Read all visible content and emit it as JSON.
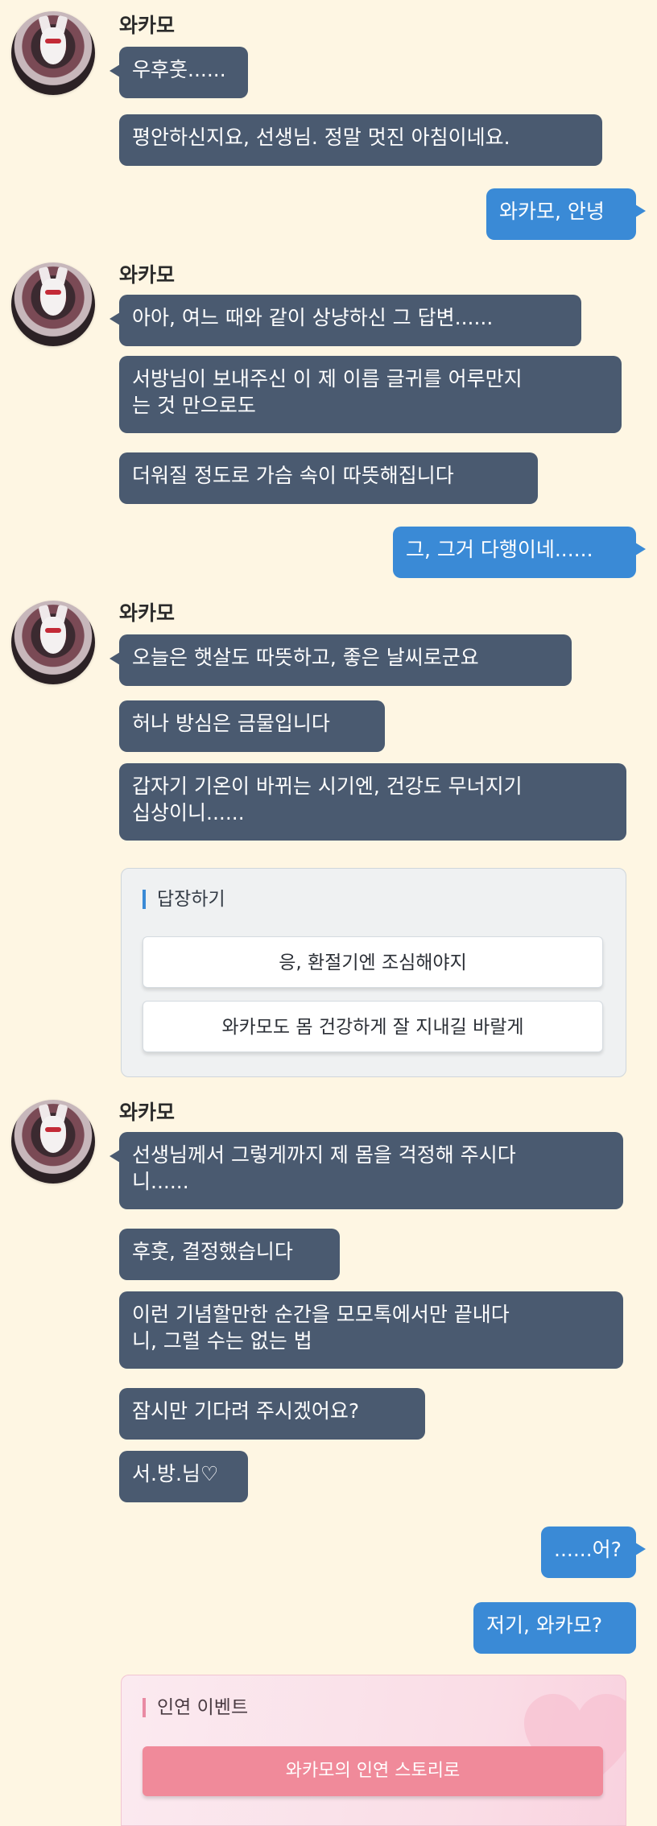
{
  "sender_name": "와카모",
  "groups": [
    {
      "messages": [
        "우후훗......",
        "평안하신지요, 선생님. 정말 멋진 아침이네요."
      ]
    },
    {
      "messages": [
        "아아, 여느 때와 같이 상냥하신 그 답변......",
        "서방님이 보내주신 이 제 이름 글귀를 어루만지\n는 것 만으로도",
        "더워질 정도로 가슴 속이 따뜻해집니다"
      ]
    },
    {
      "messages": [
        "오늘은 햇살도 따뜻하고, 좋은 날씨로군요",
        "허나 방심은 금물입니다",
        "갑자기 기온이 바뀌는 시기엔, 건강도 무너지기\n십상이니......"
      ]
    },
    {
      "messages": [
        "선생님께서 그렇게까지 제 몸을 걱정해 주시다\n니......",
        "후훗, 결정했습니다",
        "이런 기념할만한 순간을 모모톡에서만 끝내다\n니, 그럴 수는 없는 법",
        "잠시만 기다려 주시겠어요?",
        "서.방.님♡"
      ]
    }
  ],
  "user_messages": [
    "와카모, 안녕",
    "그, 그거 다행이네......",
    "......어?",
    "저기, 와카모?"
  ],
  "reply": {
    "title": "답장하기",
    "options": [
      "응, 환절기엔 조심해야지",
      "와카모도 몸 건강하게 잘 지내길 바랄게"
    ]
  },
  "event": {
    "title": "인연 이벤트",
    "button": "와카모의 인연 스토리로"
  },
  "colors": {
    "background": "#fef6e3",
    "incoming_bubble": "#4a5a70",
    "outgoing_bubble": "#3a8ad6",
    "event_button": "#f08a9a"
  }
}
